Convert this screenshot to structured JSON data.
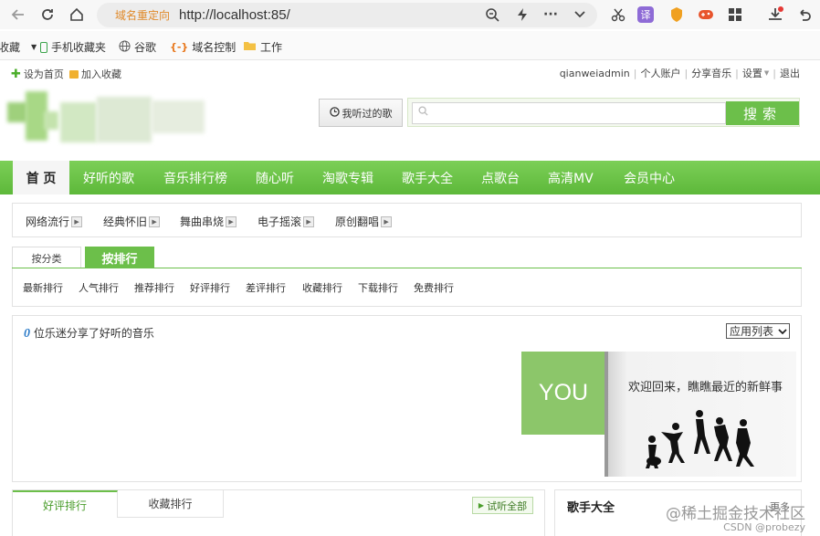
{
  "browser": {
    "address_tag": "域名重定向",
    "url": "http://localhost:85/",
    "icons": [
      "back-icon",
      "reload-icon",
      "home-icon",
      "zoom-icon",
      "lightning-icon",
      "more-icon",
      "chevron-down-icon",
      "scissors-icon",
      "translate-icon",
      "shield-icon",
      "gamepad-icon",
      "apps-grid-icon",
      "download-icon",
      "undo-icon"
    ],
    "translate_label": "译"
  },
  "bookmarks": [
    "收藏",
    "手机收藏夹",
    "谷歌",
    "域名控制",
    "工作"
  ],
  "topbar": {
    "set_home": "设为首页",
    "add_fav": "加入收藏",
    "user": "qianweiadmin",
    "account": "个人账户",
    "share": "分享音乐",
    "settings": "设置",
    "logout": "退出"
  },
  "header": {
    "heard_songs": "我听过的歌",
    "search_button": "搜索",
    "search_placeholder": ""
  },
  "nav": [
    "首 页",
    "好听的歌",
    "音乐排行榜",
    "随心听",
    "淘歌专辑",
    "歌手大全",
    "点歌台",
    "高清MV",
    "会员中心"
  ],
  "subcats": [
    "网络流行",
    "经典怀旧",
    "舞曲串烧",
    "电子摇滚",
    "原创翻唱"
  ],
  "tabs": [
    "按分类",
    "按排行"
  ],
  "ranks": [
    "最新排行",
    "人气排行",
    "推荐排行",
    "好评排行",
    "差评排行",
    "收藏排行",
    "下载排行",
    "免费排行"
  ],
  "share": {
    "count": "0",
    "text": "位乐迷分享了好听的音乐",
    "view_select": "应用列表",
    "banner_you": "YOU",
    "banner_text": "欢迎回来，瞧瞧最近的新鲜事"
  },
  "bottom": {
    "tab_good": "好评排行",
    "tab_fav": "收藏排行",
    "try_all": "试听全部",
    "singers_title": "歌手大全",
    "more": "更多"
  },
  "watermark": {
    "line1": "@稀土掘金技术社区",
    "line2": "CSDN @probezy"
  },
  "colors": {
    "brand_green": "#6cbf4a",
    "nav_green": "#5db83a",
    "count_blue": "#2d7cc9"
  }
}
